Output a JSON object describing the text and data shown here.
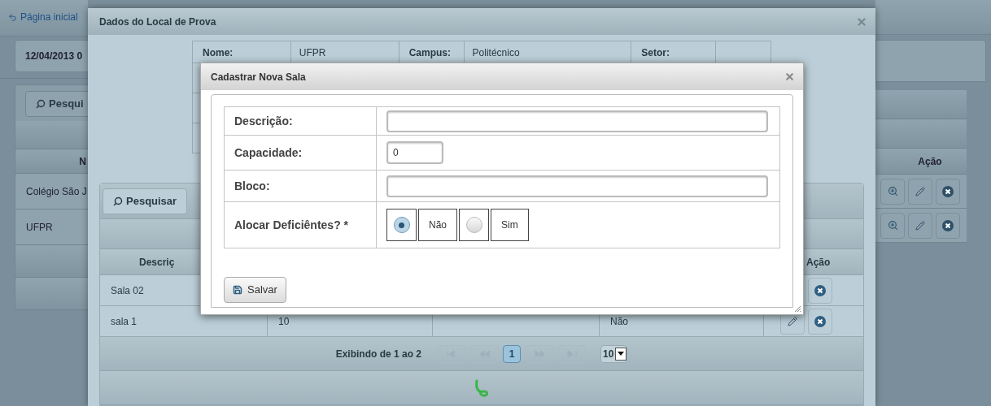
{
  "background_page": {
    "home_link": "Página inicial",
    "date_button": "12/04/2013 0",
    "search_button": "Pesqui",
    "list_table": {
      "column_1": "N",
      "action_column": "Ação",
      "rows": [
        {
          "name": "Colégio São J",
          "actions": [
            {
              "kind": "view"
            },
            {
              "kind": "edit"
            },
            {
              "kind": "delete"
            }
          ]
        },
        {
          "name": "UFPR",
          "actions": [
            {
              "kind": "view"
            },
            {
              "kind": "edit"
            },
            {
              "kind": "delete"
            }
          ]
        }
      ]
    }
  },
  "location_dialog": {
    "title": "Dados do Local de Prova",
    "info": [
      {
        "label": "Nome:",
        "value": "UFPR"
      },
      {
        "label": "Campus:",
        "value": "Politécnico"
      },
      {
        "label": "Setor:"
      }
    ],
    "search_button": "Pesquisar",
    "rooms_table": {
      "column_1": "Descriç",
      "action_column": "Ação",
      "rows": [
        {
          "description": "Sala 02",
          "actions": [
            {
              "kind": "delete"
            }
          ]
        },
        {
          "description": "sala 1",
          "column_2": "10",
          "column_4": "Não",
          "actions": [
            {
              "kind": "edit"
            },
            {
              "kind": "delete"
            }
          ]
        }
      ]
    },
    "pager": {
      "summary": "Exibindo de 1 ao 2",
      "pages": [
        {
          "label": "1",
          "selected": true
        }
      ],
      "page_size": "10"
    }
  },
  "room_dialog": {
    "title": "Cadastrar Nova Sala",
    "fields": [
      {
        "kind": "text",
        "label": "Descrição:"
      },
      {
        "kind": "number",
        "label": "Capacidade:",
        "value": "0"
      },
      {
        "kind": "text",
        "label": "Bloco:"
      },
      {
        "kind": "radio",
        "label": "Alocar Deficiêntes? *",
        "options": [
          {
            "label": "Não",
            "selected": true
          },
          {
            "label": "Sim",
            "selected": false
          }
        ]
      }
    ],
    "save_button": "Salvar"
  }
}
